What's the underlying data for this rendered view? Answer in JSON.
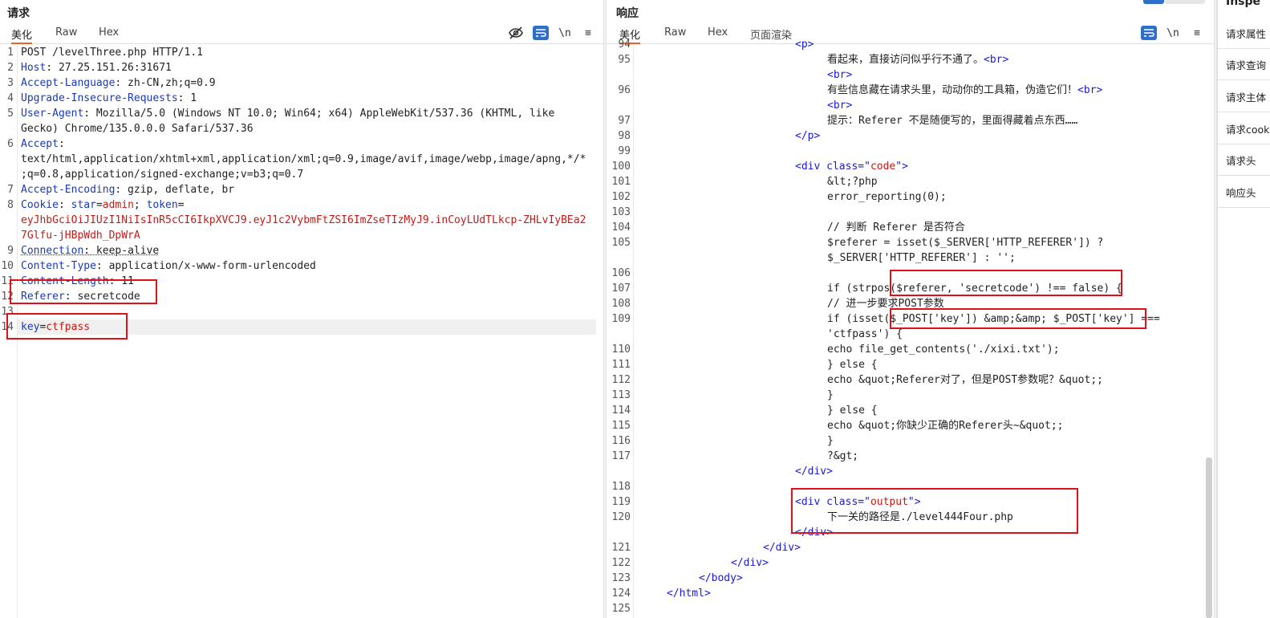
{
  "request": {
    "title": "请求",
    "tabs": [
      "美化",
      "Raw",
      "Hex"
    ],
    "tools": {
      "hide": "hide-icon",
      "wrap": "wrap-icon",
      "newline": "\\n",
      "menu": "≡"
    },
    "lines": [
      {
        "n": "1",
        "parts": [
          [
            "POST /levelThree.php HTTP/1.1",
            "hv"
          ]
        ]
      },
      {
        "n": "2",
        "parts": [
          [
            "Host",
            "hk"
          ],
          [
            ": 27.25.151.26:31671",
            "hv"
          ]
        ]
      },
      {
        "n": "3",
        "parts": [
          [
            "Accept-Language",
            "hk"
          ],
          [
            ": zh-CN,zh;q=0.9",
            "hv"
          ]
        ]
      },
      {
        "n": "4",
        "parts": [
          [
            "Upgrade-Insecure-Requests",
            "hk"
          ],
          [
            ": 1",
            "hv"
          ]
        ]
      },
      {
        "n": "5",
        "parts": [
          [
            "User-Agent",
            "hk"
          ],
          [
            ": Mozilla/5.0 (Windows NT 10.0; Win64; x64) AppleWebKit/537.36 (KHTML, like",
            "hv"
          ]
        ]
      },
      {
        "n": "",
        "parts": [
          [
            "Gecko) Chrome/135.0.0.0 Safari/537.36",
            "hv"
          ]
        ]
      },
      {
        "n": "6",
        "parts": [
          [
            "Accept",
            "hk"
          ],
          [
            ":",
            "hv"
          ]
        ]
      },
      {
        "n": "",
        "parts": [
          [
            "text/html,application/xhtml+xml,application/xml;q=0.9,image/avif,image/webp,image/apng,*/*",
            "hv"
          ]
        ]
      },
      {
        "n": "",
        "parts": [
          [
            ";q=0.8,application/signed-exchange;v=b3;q=0.7",
            "hv"
          ]
        ]
      },
      {
        "n": "7",
        "parts": [
          [
            "Accept-Encoding",
            "hk"
          ],
          [
            ": gzip, deflate, br",
            "hv"
          ]
        ]
      },
      {
        "n": "8",
        "parts": [
          [
            "Cookie",
            "hk"
          ],
          [
            ": ",
            "hv"
          ],
          [
            "star",
            "ck"
          ],
          [
            "=",
            "hv"
          ],
          [
            "admin",
            "cv"
          ],
          [
            "; ",
            "hv"
          ],
          [
            "token",
            "ck"
          ],
          [
            "=",
            "hv"
          ]
        ]
      },
      {
        "n": "",
        "parts": [
          [
            "eyJhbGciOiJIUzI1NiIsInR5cCI6IkpXVCJ9.eyJ1c2VybmFtZSI6ImZseTIzMyJ9.inCoyLUdTLkcp-ZHLvIyBEa2",
            "cv"
          ]
        ]
      },
      {
        "n": "",
        "parts": [
          [
            "7Glfu-jHBpWdh_DpWrA",
            "cv"
          ]
        ]
      },
      {
        "n": "9",
        "parts": [
          [
            "Connection",
            "hk ul"
          ],
          [
            ": keep-alive",
            "hv ul"
          ]
        ]
      },
      {
        "n": "10",
        "parts": [
          [
            "Content-Type",
            "hk"
          ],
          [
            ": application/x-www-form-urlencoded",
            "hv"
          ]
        ]
      },
      {
        "n": "11",
        "parts": [
          [
            "Content-Length",
            "hk"
          ],
          [
            ": 11",
            "hv"
          ]
        ]
      },
      {
        "n": "12",
        "parts": [
          [
            "Referer",
            "hk"
          ],
          [
            ": secretcode",
            "hv"
          ]
        ]
      },
      {
        "n": "13",
        "parts": []
      },
      {
        "n": "14",
        "parts": [
          [
            "key",
            "pk"
          ],
          [
            "=",
            "hv"
          ],
          [
            "ctfpass",
            "pv"
          ]
        ]
      }
    ]
  },
  "response": {
    "title": "响应",
    "tabs": [
      "美化",
      "Raw",
      "Hex",
      "页面渲染"
    ],
    "tools": {
      "wrap": "wrap-icon",
      "newline": "\\n",
      "menu": "≡"
    },
    "lines": [
      {
        "n": "94",
        "indent": 0,
        "parts": [
          [
            "<p>",
            "tag"
          ]
        ]
      },
      {
        "n": "95",
        "indent": 1,
        "parts": [
          [
            "看起来，直接访问似乎行不通了。",
            "hv"
          ],
          [
            "<br>",
            "tag"
          ]
        ]
      },
      {
        "n": "",
        "indent": 1,
        "parts": [
          [
            "<br>",
            "tag"
          ]
        ]
      },
      {
        "n": "96",
        "indent": 1,
        "parts": [
          [
            "有些信息藏在请求头里，动动你的工具箱，伪造它们！",
            "hv"
          ],
          [
            "<br>",
            "tag"
          ]
        ]
      },
      {
        "n": "",
        "indent": 1,
        "parts": [
          [
            "<br>",
            "tag"
          ]
        ]
      },
      {
        "n": "97",
        "indent": 1,
        "parts": [
          [
            "提示：Referer 不是随便写的，里面得藏着点东西……",
            "hv"
          ]
        ]
      },
      {
        "n": "98",
        "indent": 0,
        "parts": [
          [
            "</p>",
            "tag"
          ]
        ]
      },
      {
        "n": "99",
        "indent": 0,
        "parts": []
      },
      {
        "n": "100",
        "indent": 0,
        "parts": [
          [
            "<div ",
            "tag"
          ],
          [
            "class",
            "attr"
          ],
          [
            "=\"",
            "tag"
          ],
          [
            "code",
            "aval"
          ],
          [
            "\">",
            "tag"
          ]
        ]
      },
      {
        "n": "101",
        "indent": 1,
        "parts": [
          [
            "&lt;?php",
            "hv"
          ]
        ]
      },
      {
        "n": "102",
        "indent": 1,
        "parts": [
          [
            "error_reporting(0);",
            "hv"
          ]
        ]
      },
      {
        "n": "103",
        "indent": 1,
        "parts": []
      },
      {
        "n": "104",
        "indent": 1,
        "parts": [
          [
            "// 判断 Referer 是否符合",
            "hv"
          ]
        ]
      },
      {
        "n": "105",
        "indent": 1,
        "parts": [
          [
            "$referer = isset($_SERVER['HTTP_REFERER']) ?",
            "hv"
          ]
        ]
      },
      {
        "n": "",
        "indent": 1,
        "parts": [
          [
            "$_SERVER['HTTP_REFERER'] : '';",
            "hv"
          ]
        ]
      },
      {
        "n": "106",
        "indent": 1,
        "parts": []
      },
      {
        "n": "107",
        "indent": 1,
        "parts": [
          [
            "if (strpos($referer, 'secretcode') !== false) {",
            "hv"
          ]
        ]
      },
      {
        "n": "108",
        "indent": 1,
        "parts": [
          [
            "// 进一步要求POST参数",
            "hv"
          ]
        ]
      },
      {
        "n": "109",
        "indent": 1,
        "parts": [
          [
            "if (isset($_POST['key']) &amp;&amp; $_POST['key'] ===",
            "hv"
          ]
        ]
      },
      {
        "n": "",
        "indent": 1,
        "parts": [
          [
            "'ctfpass') {",
            "hv"
          ]
        ]
      },
      {
        "n": "110",
        "indent": 1,
        "parts": [
          [
            "echo file_get_contents('./xixi.txt');",
            "hv"
          ]
        ]
      },
      {
        "n": "111",
        "indent": 1,
        "parts": [
          [
            "} else {",
            "hv"
          ]
        ]
      },
      {
        "n": "112",
        "indent": 1,
        "parts": [
          [
            "echo &quot;Referer对了，但是POST参数呢？&quot;;",
            "hv"
          ]
        ]
      },
      {
        "n": "113",
        "indent": 1,
        "parts": [
          [
            "}",
            "hv"
          ]
        ]
      },
      {
        "n": "114",
        "indent": 1,
        "parts": [
          [
            "} else {",
            "hv"
          ]
        ]
      },
      {
        "n": "115",
        "indent": 1,
        "parts": [
          [
            "echo &quot;你缺少正确的Referer头~&quot;;",
            "hv"
          ]
        ]
      },
      {
        "n": "116",
        "indent": 1,
        "parts": [
          [
            "}",
            "hv"
          ]
        ]
      },
      {
        "n": "117",
        "indent": 1,
        "parts": [
          [
            "?&gt;",
            "hv"
          ]
        ]
      },
      {
        "n": "",
        "indent": 0,
        "parts": [
          [
            "</div>",
            "tag"
          ]
        ]
      },
      {
        "n": "118",
        "indent": 0,
        "parts": []
      },
      {
        "n": "119",
        "indent": 0,
        "parts": [
          [
            "<div ",
            "tag"
          ],
          [
            "class",
            "attr"
          ],
          [
            "=\"",
            "tag"
          ],
          [
            "output",
            "aval"
          ],
          [
            "\">",
            "tag"
          ]
        ]
      },
      {
        "n": "120",
        "indent": 1,
        "parts": [
          [
            "下一关的路径是./level444Four.php",
            "hv"
          ]
        ]
      },
      {
        "n": "",
        "indent": 0,
        "parts": [
          [
            "</div>",
            "tag"
          ]
        ]
      },
      {
        "n": "121",
        "indent": -1,
        "parts": [
          [
            "</div>",
            "tag"
          ]
        ]
      },
      {
        "n": "122",
        "indent": -2,
        "parts": [
          [
            "</div>",
            "tag"
          ]
        ]
      },
      {
        "n": "123",
        "indent": -3,
        "parts": [
          [
            "</body>",
            "tag"
          ]
        ]
      },
      {
        "n": "124",
        "indent": -4,
        "parts": [
          [
            "</html>",
            "tag"
          ]
        ]
      },
      {
        "n": "125",
        "indent": 0,
        "parts": []
      }
    ]
  },
  "inspector": {
    "title": "Inspe",
    "items": [
      "请求属性",
      "请求查询",
      "请求主体",
      "请求cookie",
      "请求头",
      "响应头"
    ]
  },
  "colors": {
    "accent": "#e8622c",
    "highlight": "#e0101a",
    "active_tool": "#2d6fc9"
  }
}
